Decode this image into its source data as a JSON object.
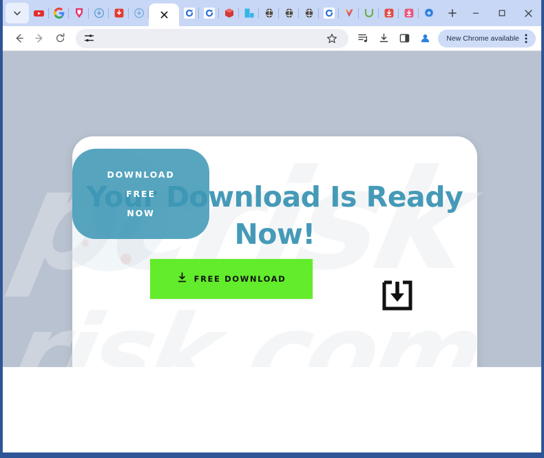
{
  "window": {
    "controls": {
      "minimize_label": "Minimize",
      "maximize_label": "Maximize",
      "close_label": "Close"
    }
  },
  "tabstrip": {
    "tab_search_label": "Search tabs",
    "new_tab_label": "New Tab",
    "active_tab": {
      "title": "",
      "close_label": "Close tab"
    },
    "background_tabs": [
      {
        "favicon": "youtube-icon",
        "color": "#e02f2f"
      },
      {
        "favicon": "google-icon",
        "color": "#4285f4"
      },
      {
        "favicon": "download-pink-icon",
        "color": "#e8336d"
      },
      {
        "favicon": "cloud-download-blue-icon",
        "color": "#5b9bd5"
      },
      {
        "favicon": "download-red-icon",
        "color": "#e33b2e"
      },
      {
        "favicon": "cloud-download-outline-icon",
        "color": "#5b9bd5"
      },
      {
        "favicon": "refresh-blue-icon",
        "color": "#2d6fd6"
      },
      {
        "favicon": "refresh-blue-icon",
        "color": "#2d6fd6"
      },
      {
        "favicon": "red-cube-icon",
        "color": "#d33a3a"
      },
      {
        "favicon": "blue-squares-icon",
        "color": "#36b5e8"
      },
      {
        "favicon": "globe-dark-icon",
        "color": "#4a4a4a"
      },
      {
        "favicon": "globe-dark-icon",
        "color": "#4a4a4a"
      },
      {
        "favicon": "globe-dark-icon",
        "color": "#4a4a4a"
      },
      {
        "favicon": "refresh-blue-icon",
        "color": "#2d6fd6"
      },
      {
        "favicon": "v-gradient-icon",
        "color": "#8d4fd6"
      },
      {
        "favicon": "green-u-icon",
        "color": "#6ab04c"
      },
      {
        "favicon": "download-red-box-icon",
        "color": "#e04b45"
      },
      {
        "favicon": "download-pink-box-icon",
        "color": "#e8577f"
      },
      {
        "favicon": "gear-blue-icon",
        "color": "#2d7fe0"
      }
    ]
  },
  "toolbar": {
    "back_label": "Back",
    "forward_label": "Forward",
    "reload_label": "Reload",
    "omnibox": {
      "value": "",
      "placeholder": "",
      "tune_icon_label": "Site settings",
      "bookmark_label": "Bookmark this tab"
    },
    "reading_list_label": "Reading list",
    "downloads_label": "Downloads",
    "side_panel_label": "Side panel",
    "profile_label": "Profile",
    "update_pill": {
      "text": "New Chrome available",
      "menu_label": "Customize and control Google Chrome"
    }
  },
  "page": {
    "watermark": {
      "line1": "pcrisk",
      "line2": "risk.com"
    },
    "headline": "Your Download Is Ready\nNow!",
    "download_button": {
      "label": "FREE DOWNLOAD",
      "icon": "download-arrow-icon",
      "background": "#62ec2b"
    },
    "download_box_icon": "download-box-icon",
    "teal_overlay": {
      "lines": [
        "DOWNLOAD",
        "FREE",
        "NOW"
      ],
      "background": "#3c96b4"
    },
    "colors": {
      "page_background": "#b9c2d0",
      "card_background": "#ffffff",
      "headline": "#459ab7",
      "accent_green": "#62ec2b",
      "accent_teal": "#3c96b4"
    }
  }
}
